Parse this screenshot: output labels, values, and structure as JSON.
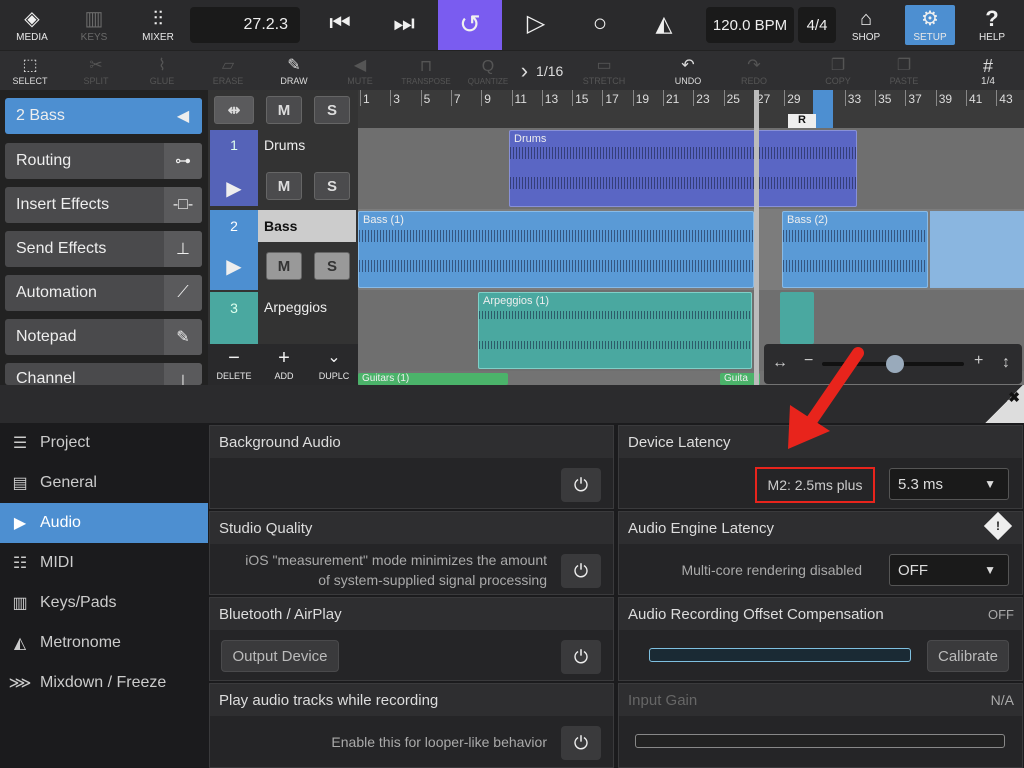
{
  "topbar": {
    "media": "MEDIA",
    "keys": "KEYS",
    "mixer": "MIXER",
    "position": "27.2.3",
    "tempo": "120.0 BPM",
    "signature": "4/4",
    "shop": "SHOP",
    "setup": "SETUP",
    "help": "HELP",
    "accent": "#7a5cf0",
    "setup_color": "#4d8fd1"
  },
  "tools": {
    "select": "SELECT",
    "split": "SPLIT",
    "glue": "GLUE",
    "erase": "ERASE",
    "draw": "DRAW",
    "mute": "MUTE",
    "transpose": "TRANSPOSE",
    "quantize": "QUANTIZE",
    "grid": "1/16",
    "stretch": "STRETCH",
    "undo": "UNDO",
    "redo": "REDO",
    "copy": "COPY",
    "paste": "PASTE",
    "snap": "1/4"
  },
  "sidebar": {
    "selected_track": "2  Bass",
    "items": [
      "Routing",
      "Insert Effects",
      "Send Effects",
      "Automation",
      "Notepad",
      "Channel"
    ]
  },
  "track_controls": {
    "m": "M",
    "s": "S",
    "delete": "DELETE",
    "add": "ADD",
    "duplicate": "DUPLC"
  },
  "tracks": [
    {
      "num": "1",
      "name": "Drums",
      "color": "#5563b8"
    },
    {
      "num": "2",
      "name": "Bass",
      "color": "#4d8fd1"
    },
    {
      "num": "3",
      "name": "Arpeggios",
      "color": "#4aa8a0"
    }
  ],
  "ruler": {
    "ticks": [
      "1",
      "3",
      "5",
      "7",
      "9",
      "11",
      "13",
      "15",
      "17",
      "19",
      "21",
      "23",
      "25",
      "27",
      "29",
      "31",
      "33",
      "35",
      "37",
      "39",
      "41",
      "43"
    ],
    "loop_marker": "R"
  },
  "clips": {
    "drums": "Drums",
    "bass1": "Bass (1)",
    "bass2": "Bass (2)",
    "arp1": "Arpeggios (1)",
    "guitars": "Guitars (1)",
    "guitars2": "Guita"
  },
  "settings": {
    "nav": [
      "Project",
      "General",
      "Audio",
      "MIDI",
      "Keys/Pads",
      "Metronome",
      "Mixdown / Freeze"
    ],
    "selected_nav": "Audio",
    "background_audio": {
      "title": "Background Audio"
    },
    "studio_quality": {
      "title": "Studio Quality",
      "desc1": "iOS \"measurement\" mode minimizes the amount",
      "desc2": "of system-supplied signal processing"
    },
    "bluetooth": {
      "title": "Bluetooth / AirPlay",
      "button": "Output Device"
    },
    "play_audio": {
      "title": "Play audio tracks while recording",
      "desc": "Enable this for looper-like behavior"
    },
    "device_latency": {
      "title": "Device Latency",
      "info": "M2: 2.5ms plus",
      "value": "5.3 ms"
    },
    "engine_latency": {
      "title": "Audio Engine Latency",
      "desc": "Multi-core rendering disabled",
      "value": "OFF"
    },
    "offset_comp": {
      "title": "Audio Recording Offset Compensation",
      "status": "OFF",
      "button": "Calibrate"
    },
    "input_gain": {
      "title": "Input Gain",
      "status": "N/A"
    }
  },
  "annotation_color": "#e8241c"
}
